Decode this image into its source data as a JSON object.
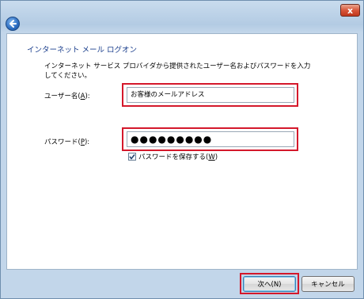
{
  "window": {
    "close_glyph": "x",
    "back_icon": "back-arrow-icon"
  },
  "heading": "インターネット メール ログオン",
  "instructions": "インターネット サービス プロバイダから提供されたユーザー名およびパスワードを入力\nしてください。",
  "username": {
    "label_prefix": "ユーザー名(",
    "label_key": "A",
    "label_suffix": "):",
    "value": "お客様のメールアドレス"
  },
  "password": {
    "label_prefix": "パスワード(",
    "label_key": "P",
    "label_suffix": "):",
    "value": "●●●●●●●●●"
  },
  "remember": {
    "label_prefix": "パスワードを保存する(",
    "label_key": "W",
    "label_suffix": ")",
    "checked": true
  },
  "buttons": {
    "next": "次へ(N)",
    "cancel": "キャンセル"
  },
  "colors": {
    "highlight": "#d4182b",
    "heading": "#1a3e8c"
  }
}
